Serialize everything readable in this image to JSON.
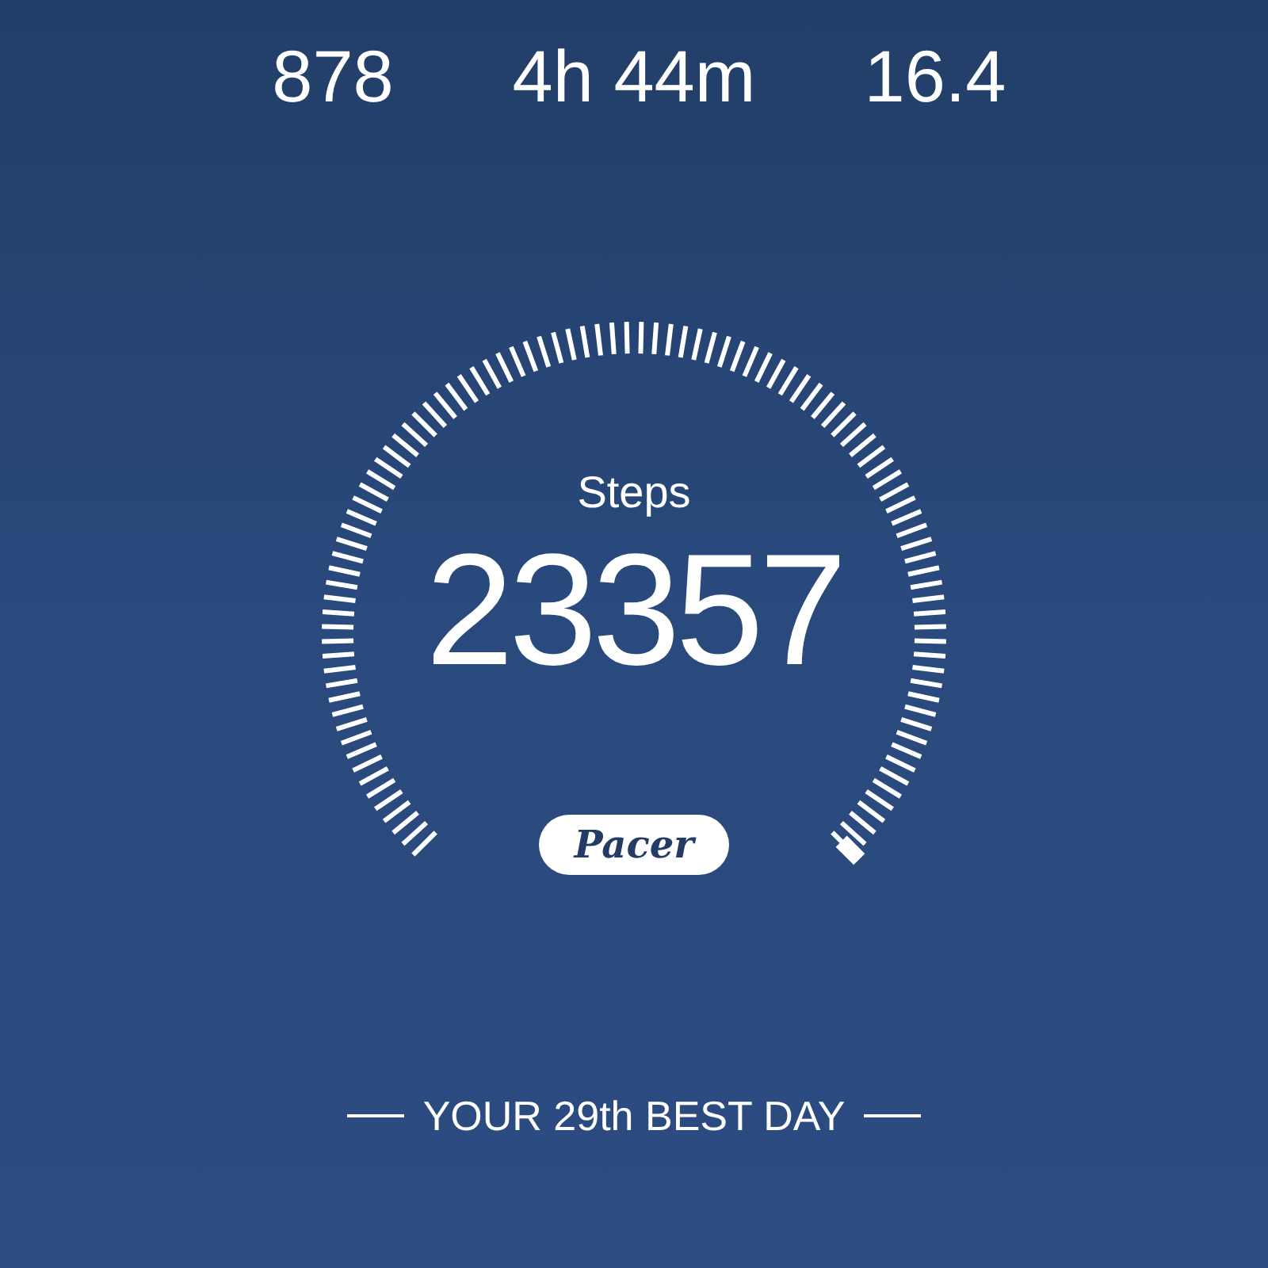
{
  "stats": [
    {
      "value": "878"
    },
    {
      "value": "4h 44m"
    },
    {
      "value": "16.4"
    }
  ],
  "gauge": {
    "label": "Steps",
    "value": "23357",
    "logo": "Pacer"
  },
  "footer": {
    "text": "YOUR 29th BEST DAY"
  }
}
